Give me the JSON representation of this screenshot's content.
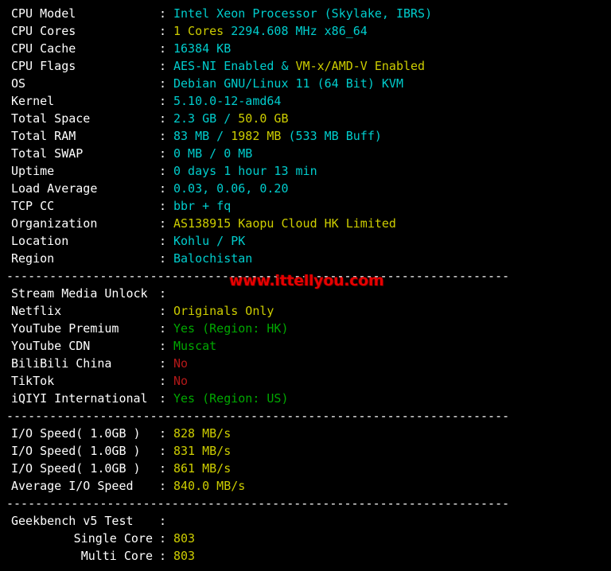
{
  "terminal": {
    "background_color": "#000000",
    "colors": {
      "label": "#ffffff",
      "cyan": "#00cdcd",
      "yellow": "#cdcd00",
      "green": "#00a800",
      "red": "#b21818",
      "watermark": "#e60000"
    },
    "separator": "----------------------------------------------------------------------",
    "watermark_text": "www.ittellyou.com",
    "colon": ":",
    "sections": [
      {
        "name": "system-info",
        "rows": [
          {
            "label": "CPU Model",
            "indent": false,
            "segments": [
              {
                "text": "Intel Xeon Processor (Skylake, IBRS)",
                "color": "cyan"
              }
            ]
          },
          {
            "label": "CPU Cores",
            "indent": false,
            "segments": [
              {
                "text": "1 Cores ",
                "color": "yellow"
              },
              {
                "text": "2294.608 MHz x86_64",
                "color": "cyan"
              }
            ]
          },
          {
            "label": "CPU Cache",
            "indent": false,
            "segments": [
              {
                "text": "16384 KB",
                "color": "cyan"
              }
            ]
          },
          {
            "label": "CPU Flags",
            "indent": false,
            "segments": [
              {
                "text": "AES-NI Enabled & ",
                "color": "cyan"
              },
              {
                "text": "VM-x/AMD-V Enabled",
                "color": "yellow"
              }
            ]
          },
          {
            "label": "OS",
            "indent": false,
            "segments": [
              {
                "text": "Debian GNU/Linux 11 (64 Bit) KVM",
                "color": "cyan"
              }
            ]
          },
          {
            "label": "Kernel",
            "indent": false,
            "segments": [
              {
                "text": "5.10.0-12-amd64",
                "color": "cyan"
              }
            ]
          },
          {
            "label": "Total Space",
            "indent": false,
            "segments": [
              {
                "text": "2.3 GB / ",
                "color": "cyan"
              },
              {
                "text": "50.0 GB",
                "color": "yellow"
              }
            ]
          },
          {
            "label": "Total RAM",
            "indent": false,
            "segments": [
              {
                "text": "83 MB / ",
                "color": "cyan"
              },
              {
                "text": "1982 MB ",
                "color": "yellow"
              },
              {
                "text": "(533 MB Buff)",
                "color": "cyan"
              }
            ]
          },
          {
            "label": "Total SWAP",
            "indent": false,
            "segments": [
              {
                "text": "0 MB / 0 MB",
                "color": "cyan"
              }
            ]
          },
          {
            "label": "Uptime",
            "indent": false,
            "segments": [
              {
                "text": "0 days 1 hour 13 min",
                "color": "cyan"
              }
            ]
          },
          {
            "label": "Load Average",
            "indent": false,
            "segments": [
              {
                "text": "0.03, 0.06, 0.20",
                "color": "cyan"
              }
            ]
          },
          {
            "label": "TCP CC",
            "indent": false,
            "segments": [
              {
                "text": "bbr + fq",
                "color": "cyan"
              }
            ]
          },
          {
            "label": "Organization",
            "indent": false,
            "segments": [
              {
                "text": "AS138915 Kaopu Cloud HK Limited",
                "color": "yellow"
              }
            ]
          },
          {
            "label": "Location",
            "indent": false,
            "segments": [
              {
                "text": "Kohlu / PK",
                "color": "cyan"
              }
            ]
          },
          {
            "label": "Region",
            "indent": false,
            "segments": [
              {
                "text": "Balochistan",
                "color": "cyan"
              }
            ]
          }
        ]
      },
      {
        "name": "stream-media-unlock",
        "rows": [
          {
            "label": "Stream Media Unlock",
            "indent": false,
            "segments": []
          },
          {
            "label": "Netflix",
            "indent": false,
            "segments": [
              {
                "text": "Originals Only",
                "color": "yellow"
              }
            ]
          },
          {
            "label": "YouTube Premium",
            "indent": false,
            "segments": [
              {
                "text": "Yes (Region: HK)",
                "color": "green"
              }
            ]
          },
          {
            "label": "YouTube CDN",
            "indent": false,
            "segments": [
              {
                "text": "Muscat",
                "color": "green"
              }
            ]
          },
          {
            "label": "BiliBili China",
            "indent": false,
            "segments": [
              {
                "text": "No",
                "color": "red"
              }
            ]
          },
          {
            "label": "TikTok",
            "indent": false,
            "segments": [
              {
                "text": "No",
                "color": "red"
              }
            ]
          },
          {
            "label": "iQIYI International",
            "indent": false,
            "segments": [
              {
                "text": "Yes (Region: US)",
                "color": "green"
              }
            ]
          }
        ]
      },
      {
        "name": "io-speed",
        "rows": [
          {
            "label": "I/O Speed( 1.0GB )",
            "indent": false,
            "segments": [
              {
                "text": "828 MB/s",
                "color": "yellow"
              }
            ]
          },
          {
            "label": "I/O Speed( 1.0GB )",
            "indent": false,
            "segments": [
              {
                "text": "831 MB/s",
                "color": "yellow"
              }
            ]
          },
          {
            "label": "I/O Speed( 1.0GB )",
            "indent": false,
            "segments": [
              {
                "text": "861 MB/s",
                "color": "yellow"
              }
            ]
          },
          {
            "label": "Average I/O Speed",
            "indent": false,
            "segments": [
              {
                "text": "840.0 MB/s",
                "color": "yellow"
              }
            ]
          }
        ]
      },
      {
        "name": "geekbench",
        "rows": [
          {
            "label": "Geekbench v5 Test",
            "indent": false,
            "segments": []
          },
          {
            "label": "Single Core",
            "indent": true,
            "segments": [
              {
                "text": "803",
                "color": "yellow"
              }
            ]
          },
          {
            "label": "Multi Core",
            "indent": true,
            "segments": [
              {
                "text": "803",
                "color": "yellow"
              }
            ]
          }
        ]
      }
    ]
  }
}
